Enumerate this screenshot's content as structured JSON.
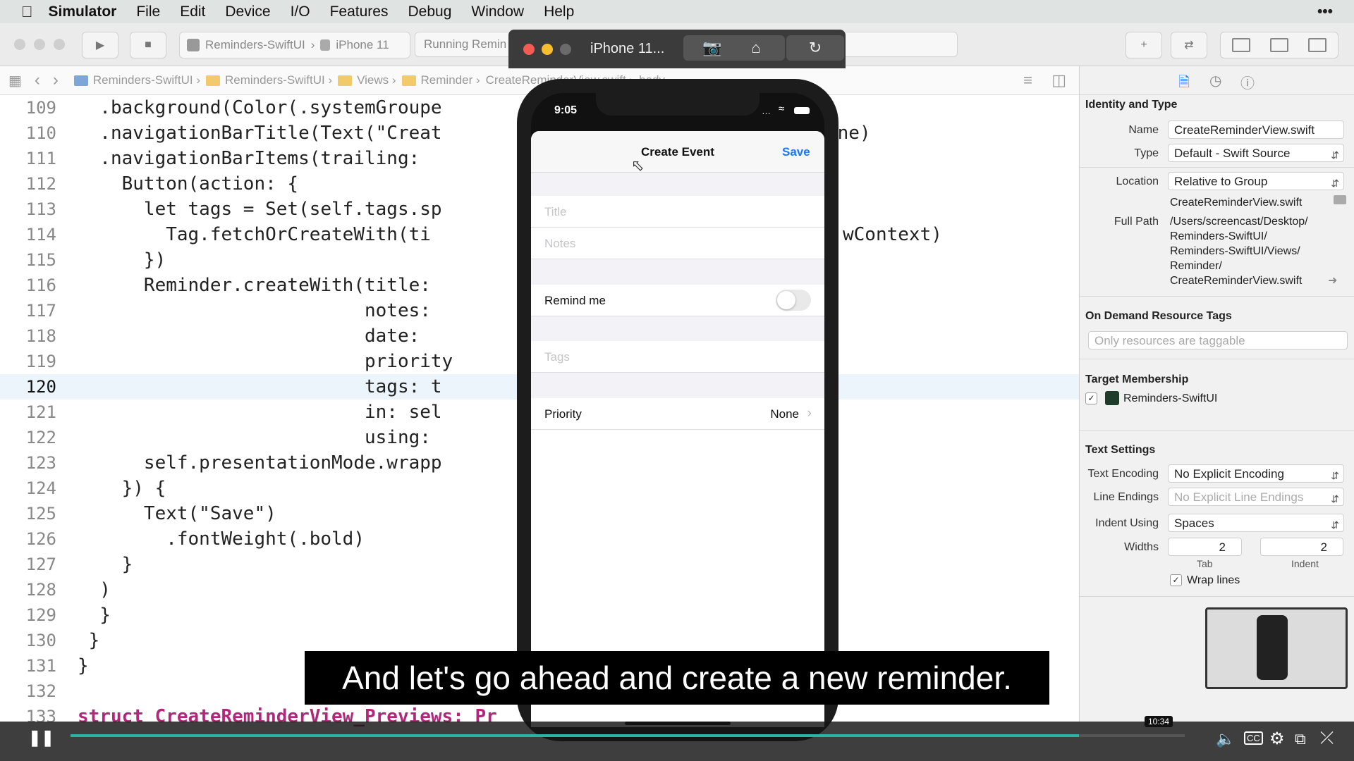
{
  "menubar": {
    "app": "Simulator",
    "items": [
      "File",
      "Edit",
      "Device",
      "I/O",
      "Features",
      "Debug",
      "Window",
      "Help"
    ],
    "more": "•••"
  },
  "toolbar": {
    "scheme_target": "Reminders-SwiftUI",
    "scheme_device": "iPhone 11",
    "status": "Running Remin"
  },
  "jumpbar": {
    "crumbs": [
      "Reminders-SwiftUI",
      "Reminders-SwiftUI",
      "Views",
      "Reminder",
      "CreateReminderView.swift",
      "body"
    ]
  },
  "editor": {
    "lines": [
      {
        "n": "109",
        "t": "  .background(Color(.systemGroupe"
      },
      {
        "n": "110",
        "t": "  .navigationBarTitle(Text(\"Creat"
      },
      {
        "n": "111",
        "t": "  .navigationBarItems(trailing:"
      },
      {
        "n": "112",
        "t": "    Button(action: {"
      },
      {
        "n": "113",
        "t": "      let tags = Set(self.tags.sp"
      },
      {
        "n": "114",
        "t": "        Tag.fetchOrCreateWith(ti"
      },
      {
        "n": "115",
        "t": "      })"
      },
      {
        "n": "116",
        "t": "      Reminder.createWith(title:"
      },
      {
        "n": "117",
        "t": "                          notes:"
      },
      {
        "n": "118",
        "t": "                          date:"
      },
      {
        "n": "119",
        "t": "                          priority"
      },
      {
        "n": "120",
        "t": "                          tags: t"
      },
      {
        "n": "121",
        "t": "                          in: sel"
      },
      {
        "n": "122",
        "t": "                          using:"
      },
      {
        "n": "123",
        "t": "      self.presentationMode.wrapp"
      },
      {
        "n": "124",
        "t": "    }) {"
      },
      {
        "n": "125",
        "t": "      Text(\"Save\")"
      },
      {
        "n": "126",
        "t": "        .fontWeight(.bold)"
      },
      {
        "n": "127",
        "t": "    }"
      },
      {
        "n": "128",
        "t": "  )"
      },
      {
        "n": "129",
        "t": "  }"
      },
      {
        "n": "130",
        "t": " }"
      },
      {
        "n": "131",
        "t": "}"
      },
      {
        "n": "132",
        "t": ""
      },
      {
        "n": "133",
        "t": "struct CreateReminderView_Previews: Pr"
      }
    ],
    "current_line": "120",
    "overflow_110": "ine)",
    "overflow_114": "wContext)"
  },
  "inspector": {
    "identity_header": "Identity and Type",
    "name_label": "Name",
    "name_value": "CreateReminderView.swift",
    "type_label": "Type",
    "type_value": "Default - Swift Source",
    "location_label": "Location",
    "location_value": "Relative to Group",
    "location_file": "CreateReminderView.swift",
    "fullpath_label": "Full Path",
    "fullpath_lines": [
      "/Users/screencast/Desktop/",
      "Reminders-SwiftUI/",
      "Reminders-SwiftUI/Views/",
      "Reminder/",
      "CreateReminderView.swift"
    ],
    "odr_header": "On Demand Resource Tags",
    "odr_placeholder": "Only resources are taggable",
    "target_header": "Target Membership",
    "target_name": "Reminders-SwiftUI",
    "text_header": "Text Settings",
    "encoding_label": "Text Encoding",
    "encoding_value": "No Explicit Encoding",
    "endings_label": "Line Endings",
    "endings_value": "No Explicit Line Endings",
    "indent_label": "Indent Using",
    "indent_value": "Spaces",
    "widths_label": "Widths",
    "tab_value": "2",
    "indent_width_value": "2",
    "tab_caption": "Tab",
    "indent_caption": "Indent",
    "wrap_label": "Wrap lines"
  },
  "simulator": {
    "title": "iPhone 11...",
    "time": "9:05",
    "nav_title": "Create Event",
    "save": "Save",
    "title_placeholder": "Title",
    "notes_placeholder": "Notes",
    "remind_me": "Remind me",
    "tags_placeholder": "Tags",
    "priority_label": "Priority",
    "priority_value": "None"
  },
  "subtitle": "And let's go ahead and create a new reminder.",
  "video": {
    "time": "10:34",
    "progress": 0.905
  }
}
